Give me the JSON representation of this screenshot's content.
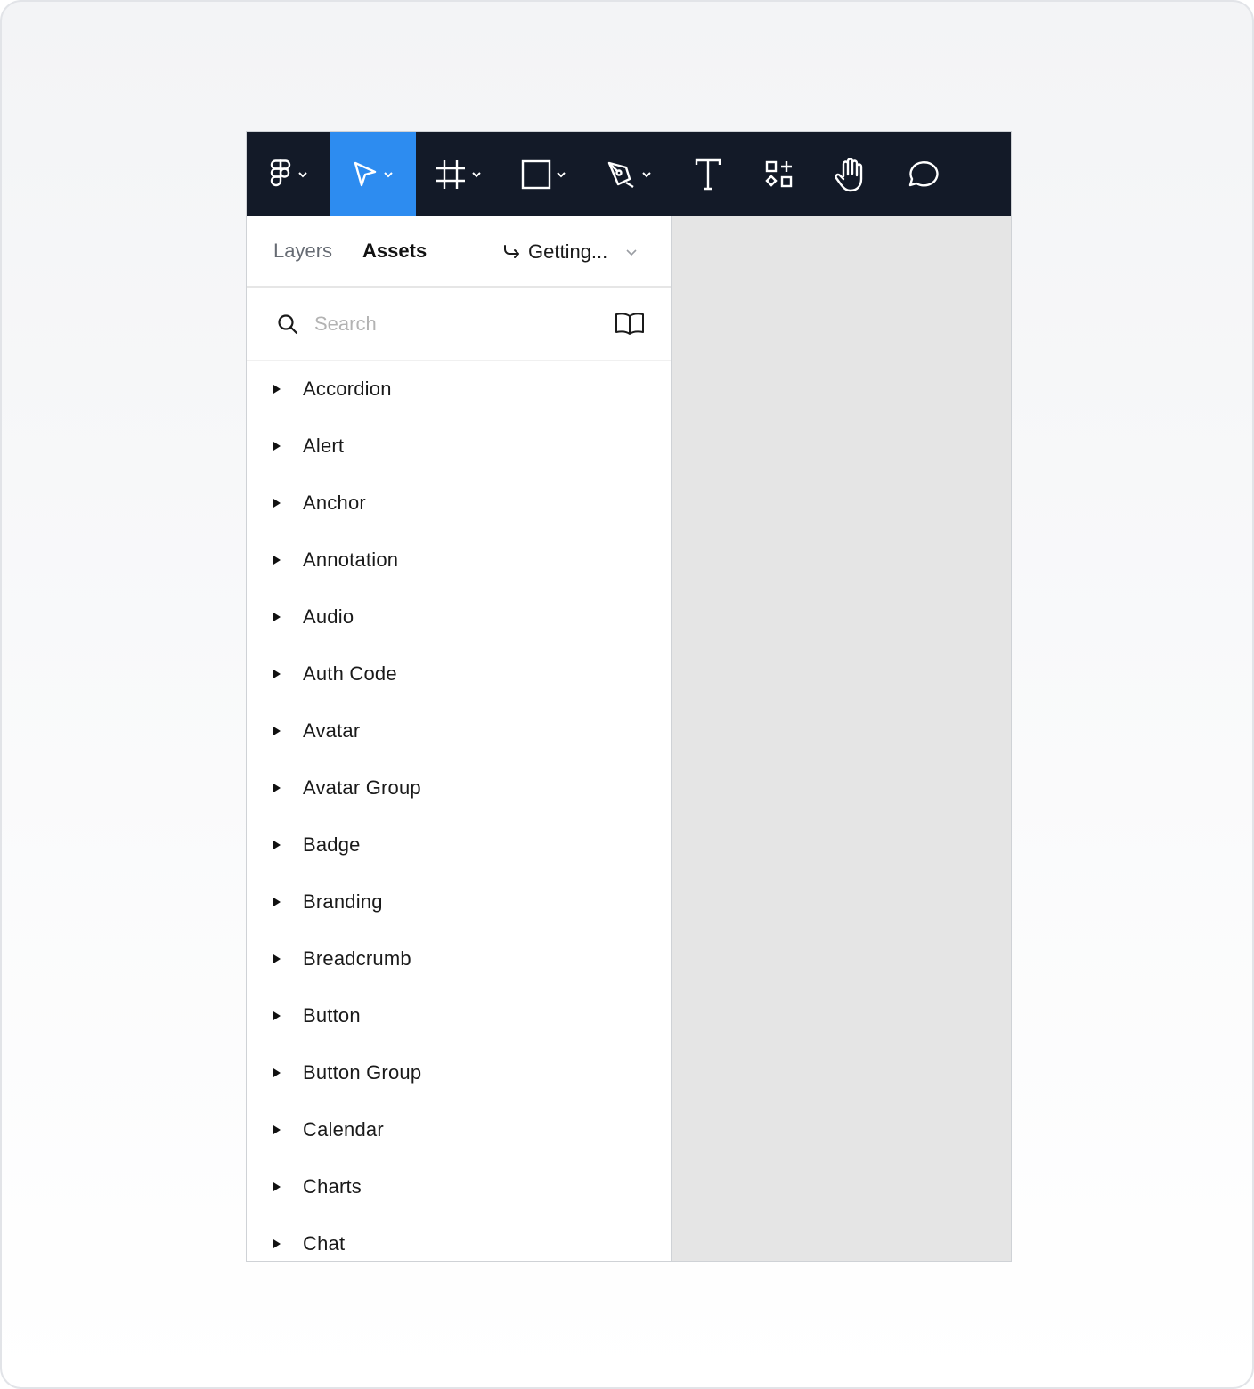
{
  "toolbar": {
    "tools": [
      {
        "icon": "figma-logo-icon",
        "dropdown": true
      },
      {
        "icon": "move-cursor-icon",
        "dropdown": true,
        "active": true
      },
      {
        "icon": "frame-icon",
        "dropdown": true
      },
      {
        "icon": "rectangle-icon",
        "dropdown": true
      },
      {
        "icon": "pen-icon",
        "dropdown": true
      },
      {
        "icon": "text-icon",
        "dropdown": false
      },
      {
        "icon": "resources-icon",
        "dropdown": false
      },
      {
        "icon": "hand-icon",
        "dropdown": false
      },
      {
        "icon": "comment-icon",
        "dropdown": false
      }
    ],
    "active_color": "#2d8cf0",
    "background_color": "#131a28"
  },
  "panel": {
    "tabs": [
      {
        "label": "Layers",
        "active": false
      },
      {
        "label": "Assets",
        "active": true
      }
    ],
    "page_selector": {
      "label": "Getting..."
    },
    "search": {
      "placeholder": "Search"
    },
    "items": [
      {
        "label": "Accordion"
      },
      {
        "label": "Alert"
      },
      {
        "label": "Anchor"
      },
      {
        "label": "Annotation"
      },
      {
        "label": "Audio"
      },
      {
        "label": "Auth Code"
      },
      {
        "label": "Avatar"
      },
      {
        "label": "Avatar Group"
      },
      {
        "label": "Badge"
      },
      {
        "label": "Branding"
      },
      {
        "label": "Breadcrumb"
      },
      {
        "label": "Button"
      },
      {
        "label": "Button Group"
      },
      {
        "label": "Calendar"
      },
      {
        "label": "Charts"
      },
      {
        "label": "Chat"
      }
    ]
  }
}
